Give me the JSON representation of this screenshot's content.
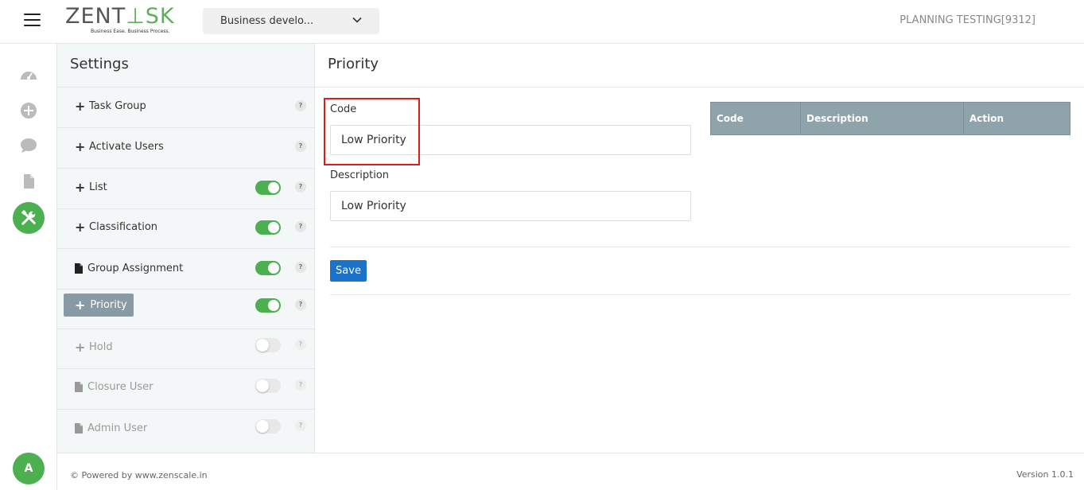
{
  "header": {
    "logo_text_1": "ZENT",
    "logo_text_2": "SK",
    "logo_tagline": "Business Ease. Business Process.",
    "project_select": "Business develo...",
    "user": "PLANNING TESTING[9312]"
  },
  "rail": {
    "icons": [
      "dashboard-icon",
      "add-icon",
      "chat-icon",
      "document-icon",
      "tools-icon"
    ],
    "avatar_initial": "A"
  },
  "settings": {
    "title": "Settings",
    "items": [
      {
        "label": "Task Group",
        "icon": "plus-icon",
        "toggle": null,
        "enabled": true,
        "selected": false
      },
      {
        "label": "Activate Users",
        "icon": "plus-icon",
        "toggle": null,
        "enabled": true,
        "selected": false
      },
      {
        "label": "List",
        "icon": "plus-icon",
        "toggle": "on",
        "enabled": true,
        "selected": false
      },
      {
        "label": "Classification",
        "icon": "plus-icon",
        "toggle": "on",
        "enabled": true,
        "selected": false
      },
      {
        "label": "Group Assignment",
        "icon": "document-icon",
        "toggle": "on",
        "enabled": true,
        "selected": false
      },
      {
        "label": "Priority",
        "icon": "plus-icon",
        "toggle": "on",
        "enabled": true,
        "selected": true
      },
      {
        "label": "Hold",
        "icon": "plus-icon",
        "toggle": "off",
        "enabled": false,
        "selected": false
      },
      {
        "label": "Closure User",
        "icon": "document-icon",
        "toggle": "off",
        "enabled": false,
        "selected": false
      },
      {
        "label": "Admin User",
        "icon": "document-icon",
        "toggle": "off",
        "enabled": false,
        "selected": false
      }
    ],
    "help_glyph": "?"
  },
  "main": {
    "title": "Priority",
    "code_label": "Code",
    "code_value": "Low Priority",
    "description_label": "Description",
    "description_value": "Low Priority",
    "save_label": "Save",
    "table_headers": [
      "Code",
      "Description",
      "Action"
    ]
  },
  "footer": {
    "powered": "© Powered by www.zenscale.in",
    "version": "Version 1.0.1"
  },
  "colors": {
    "accent_green": "#4caf50",
    "primary_blue": "#1a73c9",
    "table_header": "#8fa3ab",
    "highlight_red": "#e01b1b"
  }
}
